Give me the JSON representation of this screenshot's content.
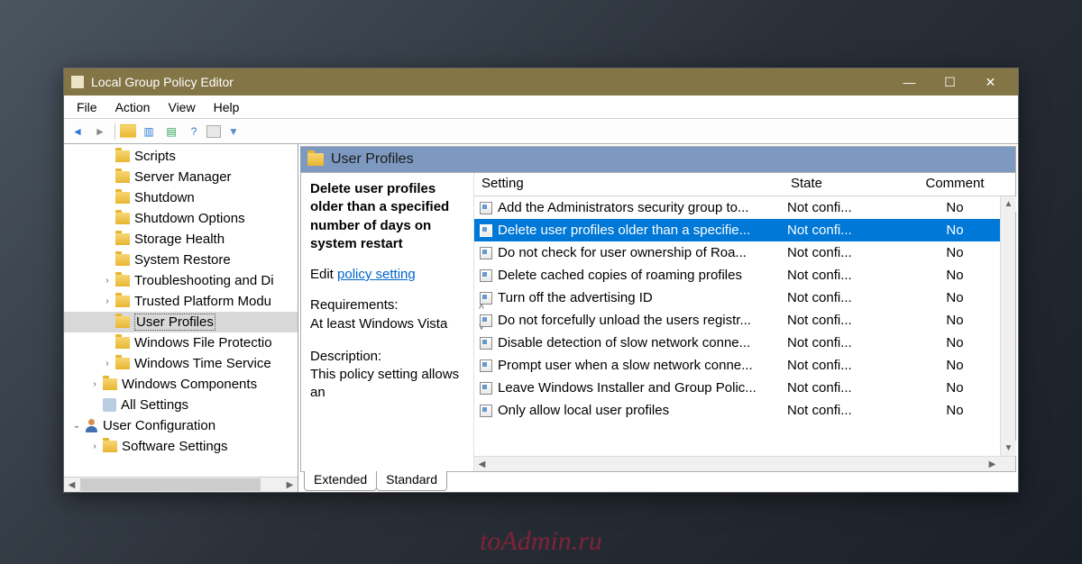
{
  "window": {
    "title": "Local Group Policy Editor"
  },
  "menu": {
    "file": "File",
    "action": "Action",
    "view": "View",
    "help": "Help"
  },
  "tree": {
    "items": [
      {
        "label": "Scripts",
        "indent": 2,
        "icon": "folder"
      },
      {
        "label": "Server Manager",
        "indent": 2,
        "icon": "folder"
      },
      {
        "label": "Shutdown",
        "indent": 2,
        "icon": "folder"
      },
      {
        "label": "Shutdown Options",
        "indent": 2,
        "icon": "folder"
      },
      {
        "label": "Storage Health",
        "indent": 2,
        "icon": "folder"
      },
      {
        "label": "System Restore",
        "indent": 2,
        "icon": "folder"
      },
      {
        "label": "Troubleshooting and Di",
        "indent": 2,
        "icon": "folder",
        "expander": ">"
      },
      {
        "label": "Trusted Platform Modu",
        "indent": 2,
        "icon": "folder",
        "expander": ">"
      },
      {
        "label": "User Profiles",
        "indent": 2,
        "icon": "folder",
        "selected": true
      },
      {
        "label": "Windows File Protectio",
        "indent": 2,
        "icon": "folder"
      },
      {
        "label": "Windows Time Service",
        "indent": 2,
        "icon": "folder",
        "expander": ">"
      },
      {
        "label": "Windows Components",
        "indent": 1,
        "icon": "folder",
        "expander": ">"
      },
      {
        "label": "All Settings",
        "indent": 1,
        "icon": "settings"
      },
      {
        "label": "User Configuration",
        "indent": 0,
        "icon": "user",
        "expander": "v"
      },
      {
        "label": "Software Settings",
        "indent": 1,
        "icon": "folder",
        "expander": ">"
      }
    ]
  },
  "right": {
    "header": "User Profiles",
    "detail": {
      "title": "Delete user profiles older than a specified number of days on system restart",
      "edit_prefix": "Edit",
      "edit_link": "policy setting",
      "req_label": "Requirements:",
      "req_value": "At least Windows Vista",
      "desc_label": "Description:",
      "desc_value": "This policy setting allows an"
    },
    "columns": {
      "setting": "Setting",
      "state": "State",
      "comment": "Comment"
    },
    "rows": [
      {
        "setting": "Add the Administrators security group to...",
        "state": "Not confi...",
        "comment": "No"
      },
      {
        "setting": "Delete user profiles older than a specifie...",
        "state": "Not confi...",
        "comment": "No",
        "selected": true
      },
      {
        "setting": "Do not check for user ownership of Roa...",
        "state": "Not confi...",
        "comment": "No"
      },
      {
        "setting": "Delete cached copies of roaming profiles",
        "state": "Not confi...",
        "comment": "No"
      },
      {
        "setting": "Turn off the advertising ID",
        "state": "Not confi...",
        "comment": "No"
      },
      {
        "setting": "Do not forcefully unload the users registr...",
        "state": "Not confi...",
        "comment": "No"
      },
      {
        "setting": "Disable detection of slow network conne...",
        "state": "Not confi...",
        "comment": "No"
      },
      {
        "setting": "Prompt user when a slow network conne...",
        "state": "Not confi...",
        "comment": "No"
      },
      {
        "setting": "Leave Windows Installer and Group Polic...",
        "state": "Not confi...",
        "comment": "No"
      },
      {
        "setting": "Only allow local user profiles",
        "state": "Not confi...",
        "comment": "No"
      }
    ],
    "tabs": {
      "extended": "Extended",
      "standard": "Standard"
    }
  },
  "watermark": "toAdmin.ru"
}
